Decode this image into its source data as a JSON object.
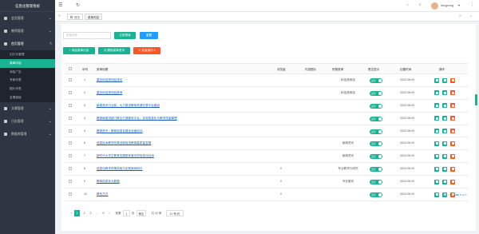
{
  "app": {
    "title": "信息化管理系统"
  },
  "sidebar": {
    "items": [
      {
        "label": "会员管理"
      },
      {
        "label": "教师管理"
      },
      {
        "label": "首页管理"
      },
      {
        "label": "文章管理"
      },
      {
        "label": "日志管理"
      },
      {
        "label": "数据库管理"
      }
    ],
    "sub_items": [
      {
        "label": "幻灯片管理"
      },
      {
        "label": "菜单内容"
      },
      {
        "label": "添加广告"
      },
      {
        "label": "专家列表"
      },
      {
        "label": "图片列表"
      },
      {
        "label": "友情链接"
      }
    ]
  },
  "topbar": {
    "user": "liangzong"
  },
  "tabs": [
    {
      "label": "首页"
    },
    {
      "label": "菜单内容"
    }
  ],
  "toolbar": {
    "search_placeholder": "菜单名称",
    "search_button": "立即搜索",
    "reset_button": "重置",
    "add_button": "添加菜单内容",
    "delete_button": "删除菜单资讯",
    "batch_button": "批量操作"
  },
  "table": {
    "headers": [
      "序号",
      "菜单标题",
      "浏览量",
      "内容图片",
      "所属菜单",
      "是否显示",
      "创建时间",
      "操作"
    ],
    "rows": [
      {
        "no": "1",
        "title": "重庆科技类网站排名",
        "views": "",
        "category": "科技类网站",
        "date": "2022-06-09"
      },
      {
        "no": "2",
        "title": "重庆科技类网站推荐",
        "views": "",
        "category": "科技类网站",
        "date": "2022-06-09"
      },
      {
        "no": "3",
        "title": "新闻资讯行业前，大力推进教育资源共享平台建设",
        "views": "",
        "category": "",
        "date": "2022-06-09"
      },
      {
        "no": "4",
        "title": "教育局推进部门联合打造服务平台，实现信息化与教学质量管理",
        "views": "",
        "category": "",
        "date": "2022-06-09"
      },
      {
        "no": "5",
        "title": "教育资讯：教育信息化建设全面启动",
        "views": "",
        "category": "",
        "date": "2022-06-09"
      },
      {
        "no": "6",
        "title": "信息技术教学改革创新促进教育高质量发展",
        "views": "",
        "category": "新闻资讯",
        "date": "2022-06-09"
      },
      {
        "no": "7",
        "title": "新时代大学生教育发展新前景中的信息化应用",
        "views": "",
        "category": "新闻资讯",
        "date": "2022-06-09"
      },
      {
        "no": "8",
        "title": "信息化教学改革探索与实践案例研讨",
        "views": "0",
        "category": "专业教学与研究",
        "date": "2022-06-09"
      },
      {
        "no": "9",
        "title": "教育信息化大数据",
        "views": "0",
        "category": "专业服务",
        "date": "2022-06-09"
      },
      {
        "no": "10",
        "title": "联系方式",
        "views": "0",
        "category": "",
        "date": "2022-06-09"
      }
    ],
    "toggle_label": "显示"
  },
  "pager": {
    "pages": [
      "1",
      "2",
      "3",
      "...",
      "5"
    ],
    "prev": "‹",
    "next": "›",
    "goto_label": "到第",
    "goto_value": "1",
    "page_unit": "页",
    "confirm": "确定",
    "total": "共 42 条",
    "per_page": "10 条/页"
  },
  "colors": {
    "sidebar": "#2f3542",
    "accent": "#19b394",
    "primary": "#1e9fff",
    "danger": "#ff5722",
    "warn": "#ff9800"
  }
}
